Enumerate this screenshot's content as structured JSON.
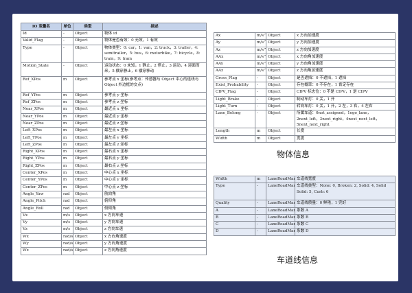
{
  "left_table": {
    "headers": [
      "IO 变量名",
      "单位",
      "类型",
      "描述"
    ],
    "rows": [
      {
        "name": "Id",
        "unit": "-",
        "type": "Object",
        "desc": "物体 id"
      },
      {
        "name": "Valid_Flag",
        "unit": "-",
        "type": "Object",
        "desc": "物体是否有效：0 无效，1 有效"
      },
      {
        "name": "Type",
        "unit": "-",
        "type": "Object",
        "desc": "物体类型：0: car，1: van，2: truck，3: trailer，4: semitrailer，5: bus，6: motorbike，7: bicycle，8: train，9: tram"
      },
      {
        "name": "Motion_State",
        "unit": "-",
        "type": "Object",
        "desc": "运动状态：0 未知，1 静止，2 停止，3 运动，4 迎面而来，5 横穿静止，6 横穿移动"
      },
      {
        "name": "Ref_XPos",
        "unit": "m",
        "type": "Object",
        "desc": "参考点 x 坐标(参考点：传感器与 Object 中心的连线与 Object 外边框的交点)"
      },
      {
        "name": "Ref_YPos",
        "unit": "m",
        "type": "Object",
        "desc": "参考点 y 坐标"
      },
      {
        "name": "Ref_ZPos",
        "unit": "m",
        "type": "Object",
        "desc": "参考点 z 坐标"
      },
      {
        "name": "Near_XPos",
        "unit": "m",
        "type": "Object",
        "desc": "最近点 x 坐标"
      },
      {
        "name": "Near_YPos",
        "unit": "m",
        "type": "Object",
        "desc": "最近点 y 坐标"
      },
      {
        "name": "Near_ZPos",
        "unit": "m",
        "type": "Object",
        "desc": "最近点 z 坐标"
      },
      {
        "name": "Left_XPos",
        "unit": "m",
        "type": "Object",
        "desc": "最左点 x 坐标"
      },
      {
        "name": "Left_YPos",
        "unit": "m",
        "type": "Object",
        "desc": "最左点 y 坐标"
      },
      {
        "name": "Left_ZPos",
        "unit": "m",
        "type": "Object",
        "desc": "最左点 z 坐标"
      },
      {
        "name": "Right_XPos",
        "unit": "m",
        "type": "Object",
        "desc": "最右点 x 坐标"
      },
      {
        "name": "Right_YPos",
        "unit": "m",
        "type": "Object",
        "desc": "最右点 y 坐标"
      },
      {
        "name": "Right_ZPos",
        "unit": "m",
        "type": "Object",
        "desc": "最右点 z 坐标"
      },
      {
        "name": "Center_XPos",
        "unit": "m",
        "type": "Object",
        "desc": "中心点 x 坐标"
      },
      {
        "name": "Center_YPos",
        "unit": "m",
        "type": "Object",
        "desc": "中心点 y 坐标"
      },
      {
        "name": "Center_ZPos",
        "unit": "m",
        "type": "Object",
        "desc": "中心点 z 坐标"
      },
      {
        "name": "Angle_Yaw",
        "unit": "rad",
        "type": "Object",
        "desc": "航向角"
      },
      {
        "name": "Angle_Pitch",
        "unit": "rad",
        "type": "Object",
        "desc": "俯仰角"
      },
      {
        "name": "Angle_Roll",
        "unit": "rad",
        "type": "Object",
        "desc": "侧倾角"
      },
      {
        "name": "Vx",
        "unit": "m/s",
        "type": "Object",
        "desc": "x 方向车速"
      },
      {
        "name": "Vy",
        "unit": "m/s",
        "type": "Object",
        "desc": "y 方向车速"
      },
      {
        "name": "Vz",
        "unit": "m/s",
        "type": "Object",
        "desc": "z 方向车速"
      },
      {
        "name": "Wx",
        "unit": "rad/s",
        "type": "Object",
        "desc": "x 方向角速度"
      },
      {
        "name": "Wy",
        "unit": "rad/s",
        "type": "Object",
        "desc": "y 方向角速度"
      },
      {
        "name": "Wz",
        "unit": "rad/s",
        "type": "Object",
        "desc": "z 方向角速度"
      }
    ]
  },
  "right_table": {
    "rows": [
      {
        "name": "Ax",
        "unit": "m/s^2",
        "type": "Object",
        "desc": "x 方向加速度"
      },
      {
        "name": "Ay",
        "unit": "m/s^2",
        "type": "Object",
        "desc": "y 方向加速度"
      },
      {
        "name": "Az",
        "unit": "m/s^2",
        "type": "Object",
        "desc": "z 方向加速度"
      },
      {
        "name": "AAx",
        "unit": "m/s^2",
        "type": "Object",
        "desc": "x 方向角加速度"
      },
      {
        "name": "AAy",
        "unit": "m/s^2",
        "type": "Object",
        "desc": "y 方向角加速度"
      },
      {
        "name": "AAz",
        "unit": "m/s^2",
        "type": "Object",
        "desc": "z 方向角加速度"
      },
      {
        "name": "Cross_Flag",
        "unit": "-",
        "type": "Object",
        "desc": "是否遮挡：0 不遮挡，1 遮挡"
      },
      {
        "name": "Exist_Probability",
        "unit": "-",
        "type": "Object",
        "desc": "存在概率：0 不存在，1 肯定存在"
      },
      {
        "name": "CIPV_Flag",
        "unit": "-",
        "type": "Object",
        "desc": "CIPV 标志位：0 不是 CIPV，1 是 CIPV"
      },
      {
        "name": "Light_Brake",
        "unit": "-",
        "type": "Object",
        "desc": "制动车灯：0 关，1 开"
      },
      {
        "name": "Light_Turn",
        "unit": "-",
        "type": "Object",
        "desc": "转向车灯：0 关，1 开，2 左，3 右，4 左右"
      },
      {
        "name": "Lane_Belong",
        "unit": "-",
        "type": "Object",
        "desc": "所属车道：0not_assigned，1ego_lane，2next_left，3next_right，4next_next_left，5next_next_right"
      },
      {
        "name": "Length",
        "unit": "m",
        "type": "Object",
        "desc": "长度"
      },
      {
        "name": "Width",
        "unit": "m",
        "type": "Object",
        "desc": "宽度"
      }
    ]
  },
  "object_caption": "物体信息",
  "lane_table": {
    "rows": [
      {
        "name": "Width",
        "unit": "m",
        "type": "LaneRoadMark",
        "desc": "车道线宽度"
      },
      {
        "name": "Type",
        "unit": "-",
        "type": "LaneRoadMark",
        "desc": "车道线类型：None: 0, Broken: 2, Solid: 4, Solid Solid: 5, Curb: 6"
      },
      {
        "name": "Quality",
        "unit": "-",
        "type": "LaneRoadMark",
        "desc": "车道线质量：0 鲜艳，1 完好"
      },
      {
        "name": "A",
        "unit": "-",
        "type": "LaneRoadMark",
        "desc": "系数 A"
      },
      {
        "name": "B",
        "unit": "-",
        "type": "LaneRoadMark",
        "desc": "系数 B"
      },
      {
        "name": "C",
        "unit": "-",
        "type": "LaneRoadMark",
        "desc": "系数 C"
      },
      {
        "name": "D",
        "unit": "-",
        "type": "LaneRoadMark",
        "desc": "系数 D"
      }
    ]
  },
  "lane_caption": "车道线信息"
}
